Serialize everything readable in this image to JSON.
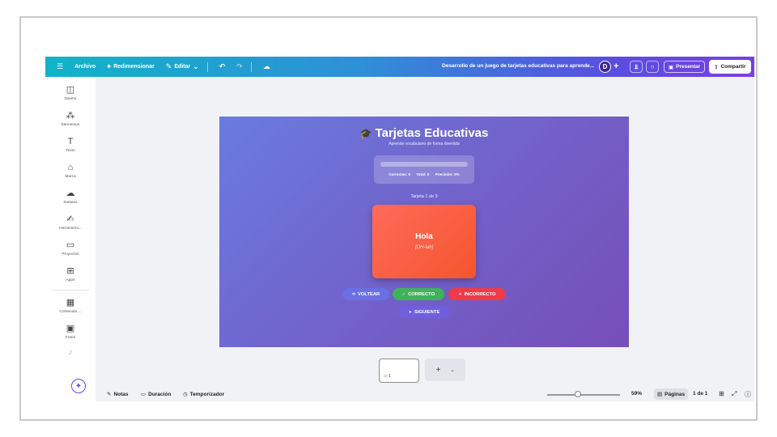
{
  "topbar": {
    "menu_icon": "hamburger-icon",
    "archivo": "Archivo",
    "redimensionar": "Redimensionar",
    "editar": "Editar",
    "document_title": "Desarrollo de un juego de tarjetas educativas para aprende...",
    "avatar_initial": "D",
    "presentar": "Presentar",
    "compartir": "Compartir",
    "colors": {
      "start": "#10b4c8",
      "end": "#7a3fe0"
    }
  },
  "sidebar": {
    "items": [
      {
        "label": "Diseño",
        "icon": "layout-icon"
      },
      {
        "label": "Elementos",
        "icon": "shapes-icon"
      },
      {
        "label": "Texto",
        "icon": "text-icon"
      },
      {
        "label": "Marca",
        "icon": "brand-icon"
      },
      {
        "label": "Subidos",
        "icon": "upload-cloud-icon"
      },
      {
        "label": "Herramient...",
        "icon": "draw-tools-icon"
      },
      {
        "label": "Proyectos",
        "icon": "folder-icon"
      },
      {
        "label": "Apps",
        "icon": "apps-icon"
      },
      {
        "label": "Contenido ...",
        "icon": "content-icon"
      },
      {
        "label": "Fotos",
        "icon": "photo-icon"
      }
    ]
  },
  "slide": {
    "title": "Tarjetas Educativas",
    "subtitle": "Aprende vocabulario de forma divertida",
    "stats": {
      "progress": 0,
      "correctas": "Correctas: 0",
      "total": "Total: 0",
      "precision": "Precisión: 0%"
    },
    "counter": "Tarjeta 1 de 5",
    "card": {
      "word": "Hola",
      "pronunciation": "[OH-lah]"
    },
    "buttons": {
      "voltear": "VOLTEAR",
      "correcto": "CORRECTO",
      "incorrecto": "INCORRECTO",
      "siguiente": "SIGUIENTE"
    }
  },
  "pages": {
    "thumb_number": "1"
  },
  "bottombar": {
    "notas": "Notas",
    "duracion": "Duración",
    "temporizador": "Temporizador",
    "zoom": "59%",
    "zoom_level": 0.42,
    "paginas": "Páginas",
    "page_count": "1 de 1"
  }
}
